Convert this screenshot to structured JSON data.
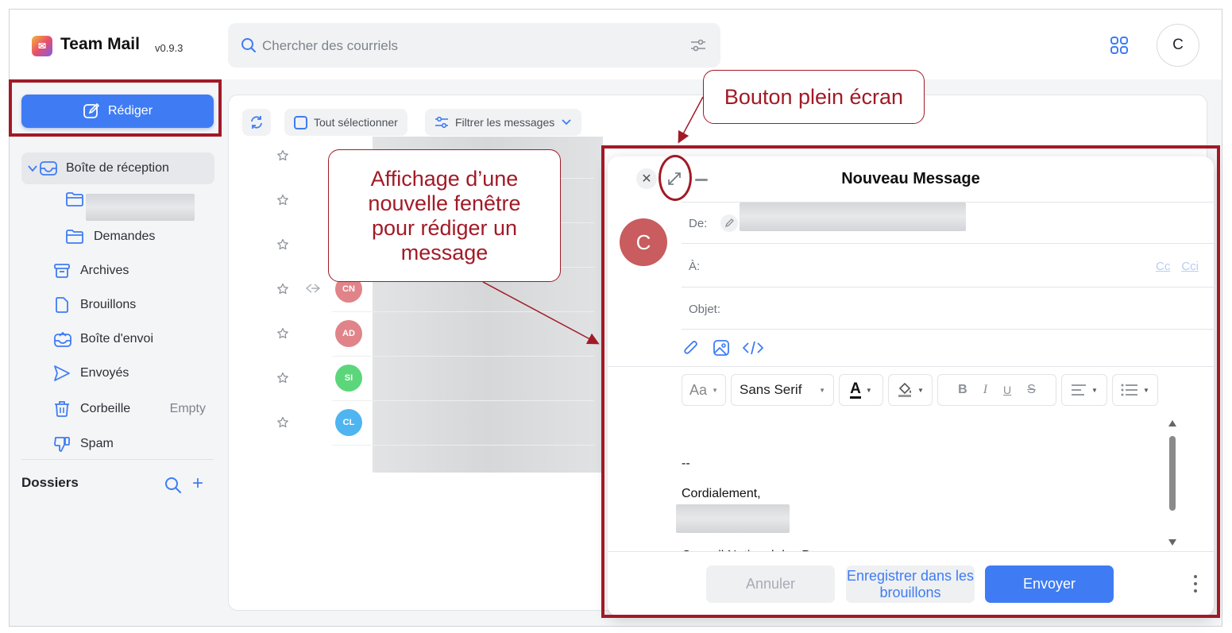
{
  "app": {
    "name": "Team Mail",
    "version": "v0.9.3",
    "user_initial": "C"
  },
  "search": {
    "placeholder": "Chercher des courriels"
  },
  "compose_button": "Rédiger",
  "sidebar": {
    "items": [
      {
        "label": "Boîte de réception"
      },
      {
        "label": ""
      },
      {
        "label": "Demandes"
      },
      {
        "label": "Archives"
      },
      {
        "label": "Brouillons"
      },
      {
        "label": "Boîte d'envoi"
      },
      {
        "label": "Envoyés"
      },
      {
        "label": "Corbeille",
        "extra": "Empty"
      },
      {
        "label": "Spam"
      }
    ],
    "folders_title": "Dossiers"
  },
  "toolbar": {
    "select_all": "Tout sélectionner",
    "filter": "Filtrer les messages"
  },
  "messages": [
    {
      "initials": ""
    },
    {
      "initials": ""
    },
    {
      "initials": ""
    },
    {
      "initials": "CN",
      "color": "#e0848a"
    },
    {
      "initials": "AD",
      "color": "#e0848a"
    },
    {
      "initials": "SI",
      "color": "#5cd67a"
    },
    {
      "initials": "CL",
      "color": "#4fb5f0"
    }
  ],
  "compose": {
    "title": "Nouveau Message",
    "avatar": "C",
    "from_label": "De:",
    "to_label": "À:",
    "cc": "Cc",
    "bcc": "Cci",
    "subject_label": "Objet:",
    "font_size": "Aa",
    "font_family": "Sans Serif",
    "body_separator": "--",
    "body_closing": "Cordialement,",
    "body_cut": "Conseil National des P...",
    "cancel": "Annuler",
    "save_draft": "Enregistrer dans les brouillons",
    "send": "Envoyer"
  },
  "annotations": {
    "fullscreen": "Bouton plein écran",
    "new_window": "Affichage d’une nouvelle fenêtre pour rédiger un message",
    "color": "#a11a26"
  },
  "colors": {
    "accent": "#3f7cf4",
    "avatar": "#c85c5e"
  }
}
